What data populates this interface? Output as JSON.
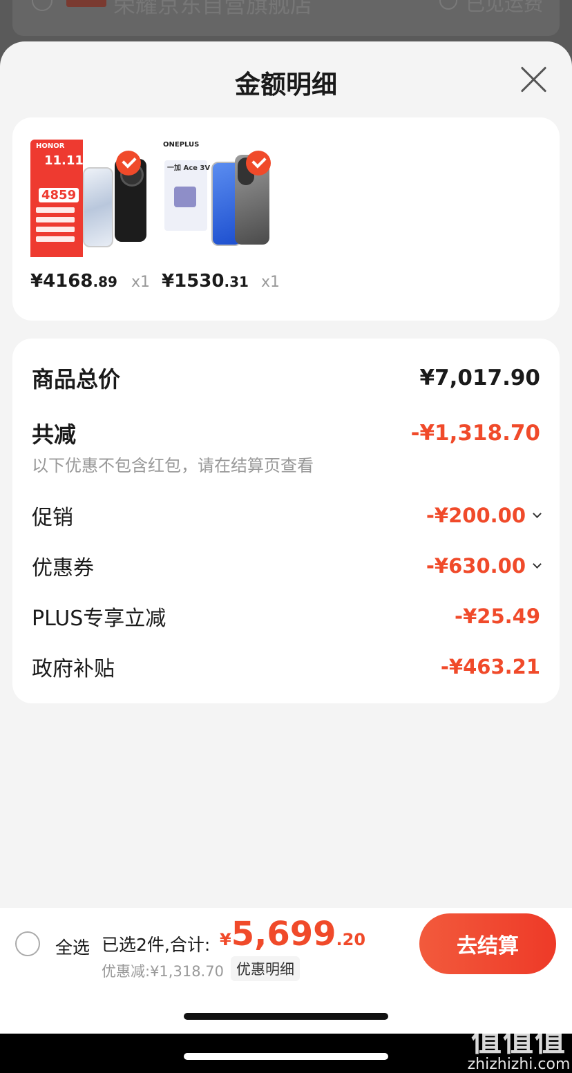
{
  "background": {
    "store_name": "荣耀京东自营旗舰店",
    "right_text": "已见运费"
  },
  "sheet": {
    "title": "金额明细"
  },
  "products": [
    {
      "brand_text": "HONOR",
      "promo_text": "11.11",
      "promo_price": "4859",
      "price_int": "¥4168",
      "price_dec": ".89",
      "qty": "x1"
    },
    {
      "brand_text": "ONEPLUS",
      "model_text": "一加 Ace 3V",
      "price_int": "¥1530",
      "price_dec": ".31",
      "qty": "x1"
    }
  ],
  "summary": {
    "total_label": "商品总价",
    "total_value": "¥7,017.90",
    "reduce_label": "共减",
    "reduce_value": "-¥1,318.70",
    "note": "以下优惠不包含红包，请在结算页查看",
    "items": [
      {
        "label": "促销",
        "value": "-¥200.00"
      },
      {
        "label": "优惠券",
        "value": "-¥630.00"
      },
      {
        "label": "PLUS专享立减",
        "value": "-¥25.49"
      },
      {
        "label": "政府补贴",
        "value": "-¥463.21"
      }
    ]
  },
  "bottom_bar": {
    "select_all": "全选",
    "selected_text": "已选2件,合计:",
    "total_currency": "¥",
    "total_int": "5,699",
    "total_dec": ".20",
    "discount_text": "优惠减:¥1,318.70",
    "detail_link": "优惠明细",
    "checkout": "去结算"
  },
  "watermark": {
    "logo": "值值值",
    "url": "zhizhizhi.com"
  },
  "colors": {
    "accent": "#f04a2a",
    "sheet_bg": "#f4f4f4",
    "card_bg": "#ffffff"
  }
}
